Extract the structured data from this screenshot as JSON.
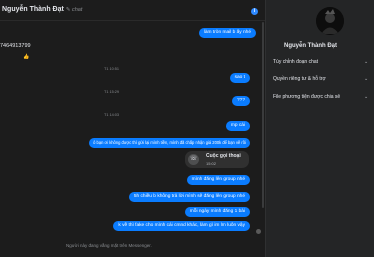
{
  "header": {
    "contact_name": "Nguyễn Thành Đạt",
    "status": "✎ chat"
  },
  "messages": {
    "left_text": "7464913799",
    "thumb": "👍",
    "outgoing": [
      "làm tròn mail b ấy nhé",
      "sao t",
      "???",
      "mp cái",
      "ô bạn ơi không được thì gửi lại mình tiền, mình đã chấp nhận giá 200k để bạn về rồi",
      "mình đăng lên group nhé",
      "5h chiều b không trả lời mình sẽ đăng lên group nhé",
      "mỗi ngày mình đăng 1 bài",
      "k về thì fake cho mình cái cmnd khác, làm gì im lm luôn vậy"
    ],
    "timestamps": [
      "T1 10:51",
      "T1 15:29",
      "T1 14:03"
    ]
  },
  "call": {
    "title": "Cuộc gọi thoại",
    "time": "15:02",
    "icon": "phone-icon"
  },
  "footer": {
    "note": "Người này đang vắng mặt trên Messenger."
  },
  "side_panel": {
    "name": "Nguyễn Thành Đạt",
    "items": [
      "Tùy chỉnh đoạn chat",
      "Quyền riêng tư & hỗ trợ",
      "File phương tiện được chia sẻ"
    ]
  },
  "colors": {
    "bubble": "#0a7cff",
    "background": "#1c1c1c",
    "panel": "#242526"
  }
}
